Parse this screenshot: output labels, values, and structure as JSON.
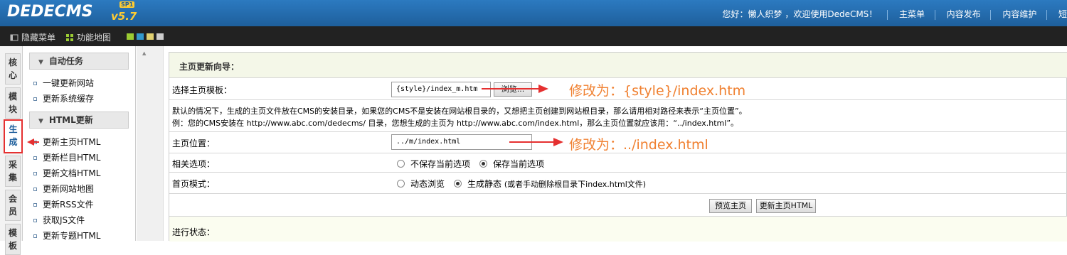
{
  "header": {
    "logo": "DEDECMS",
    "version": "v5.7",
    "sp": "SP1",
    "greeting": "您好：懒人织梦 ，欢迎使用DedeCMS！",
    "links": [
      "主菜单",
      "内容发布",
      "内容维护",
      "短"
    ]
  },
  "toolbar": {
    "hide_menu": "隐藏菜单",
    "sitemap": "功能地图",
    "swatch_colors": [
      "#9bcc33",
      "#3399cc",
      "#e0d070",
      "#cccccc"
    ]
  },
  "left_tabs": [
    "核心",
    "模块",
    "生成",
    "采集",
    "会员",
    "模板"
  ],
  "menu": {
    "group1": {
      "title": "自动任务",
      "items": [
        "一键更新网站",
        "更新系统缓存"
      ]
    },
    "group2": {
      "title": "HTML更新",
      "items": [
        "更新主页HTML",
        "更新栏目HTML",
        "更新文档HTML",
        "更新网站地图",
        "更新RSS文件",
        "获取JS文件",
        "更新专题HTML"
      ]
    }
  },
  "form": {
    "title": "主页更新向导：",
    "template_label": "选择主页模板：",
    "template_value": "{style}/index_m.htm",
    "browse_label": "浏览...",
    "note1": "默认的情况下，生成的主页文件放在CMS的安装目录，如果您的CMS不是安装在网站根目录的，又想把主页创建到网站根目录，那么请用相对路径来表示“主页位置”。",
    "note2": "例：您的CMS安装在 http://www.abc.com/dedecms/ 目录，您想生成的主页为 http://www.abc.com/index.html，那么主页位置就应该用：“../index.html”。",
    "position_label": "主页位置：",
    "position_value": "../m/index.html",
    "options_label": "相关选项：",
    "option_no_save": "不保存当前选项",
    "option_save": "保存当前选项",
    "mode_label": "首页模式：",
    "mode_dynamic": "动态浏览",
    "mode_static": "生成静态",
    "mode_static_note": "(或者手动删除根目录下index.html文件)",
    "preview_btn": "预览主页",
    "update_btn": "更新主页HTML",
    "status_label": "进行状态："
  },
  "annotations": {
    "template": "修改为：{style}/index.htm",
    "position": "修改为：../index.html"
  },
  "colors": {
    "accent_red": "#e53030",
    "annot_orange": "#f08030",
    "brand_blue": "#1e5f9c"
  }
}
